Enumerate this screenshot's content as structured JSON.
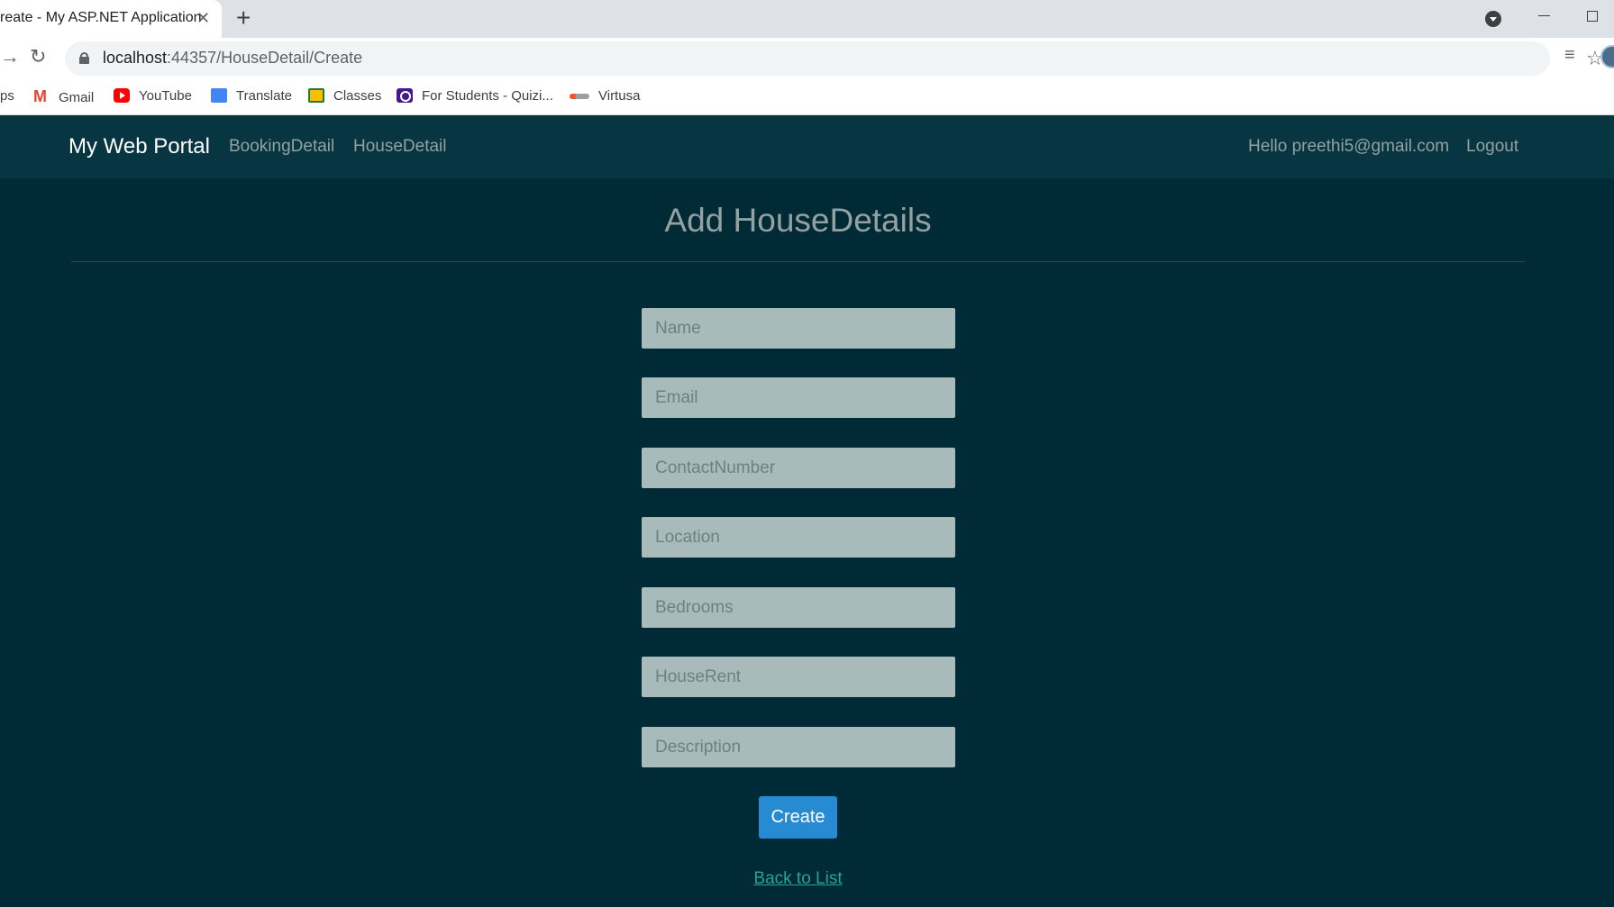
{
  "browser": {
    "tab_title": "reate - My ASP.NET Application",
    "tab_close": "✕",
    "new_tab": "+",
    "url_host": "localhost",
    "url_path": ":44357/HouseDetail/Create",
    "bookmarks": [
      {
        "label": "ps",
        "icon": "apps-icon"
      },
      {
        "label": "Gmail",
        "icon": "gmail-icon"
      },
      {
        "label": "YouTube",
        "icon": "youtube-icon"
      },
      {
        "label": "Translate",
        "icon": "translate-icon"
      },
      {
        "label": "Classes",
        "icon": "classes-icon"
      },
      {
        "label": "For Students - Quizi...",
        "icon": "quizizz-icon"
      },
      {
        "label": "Virtusa",
        "icon": "virtusa-icon"
      }
    ]
  },
  "navbar": {
    "brand": "My Web Portal",
    "links": [
      "BookingDetail",
      "HouseDetail"
    ],
    "greeting": "Hello preethi5@gmail.com",
    "logout": "Logout"
  },
  "form": {
    "title": "Add HouseDetails",
    "fields": [
      {
        "placeholder": "Name"
      },
      {
        "placeholder": "Email"
      },
      {
        "placeholder": "ContactNumber"
      },
      {
        "placeholder": "Location"
      },
      {
        "placeholder": "Bedrooms"
      },
      {
        "placeholder": "HouseRent"
      },
      {
        "placeholder": "Description"
      }
    ],
    "submit_label": "Create",
    "back_link": "Back to List"
  },
  "colors": {
    "page_bg": "#002b36",
    "navbar_bg": "#073642",
    "field_bg": "#a8baba",
    "button_bg": "#268bd2",
    "link_color": "#2aa198"
  }
}
